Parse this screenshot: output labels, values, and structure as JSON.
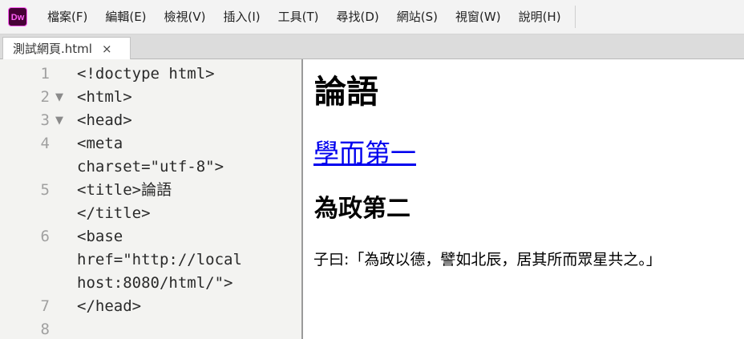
{
  "app": {
    "logo_text": "Dw",
    "brand_color": "#470137",
    "accent_color": "#ff61f6"
  },
  "menu": [
    "檔案(F)",
    "編輯(E)",
    "檢視(V)",
    "插入(I)",
    "工具(T)",
    "尋找(D)",
    "網站(S)",
    "視窗(W)",
    "說明(H)"
  ],
  "tab": {
    "label": "測試網頁.html",
    "close": "×"
  },
  "editor": {
    "lines": [
      {
        "num": "1",
        "fold": "",
        "text": [
          "<!doctype html>"
        ]
      },
      {
        "num": "2",
        "fold": "▼",
        "text": [
          "<html>"
        ]
      },
      {
        "num": "3",
        "fold": "▼",
        "text": [
          "<head>"
        ]
      },
      {
        "num": "4",
        "fold": "",
        "text": [
          "<meta",
          "charset=\"utf-8\">"
        ]
      },
      {
        "num": "5",
        "fold": "",
        "text": [
          "<title>論語",
          "</title>"
        ]
      },
      {
        "num": "6",
        "fold": "",
        "text": [
          "<base",
          "href=\"http://local",
          "host:8080/html/\">"
        ]
      },
      {
        "num": "7",
        "fold": "",
        "text": [
          "</head>"
        ]
      },
      {
        "num": "8",
        "fold": "",
        "text": [
          ""
        ]
      }
    ]
  },
  "preview": {
    "h1": "論語",
    "link": "學而第一",
    "h2": "為政第二",
    "paragraph": "子曰:「為政以德，譬如北辰，居其所而眾星共之。」"
  }
}
